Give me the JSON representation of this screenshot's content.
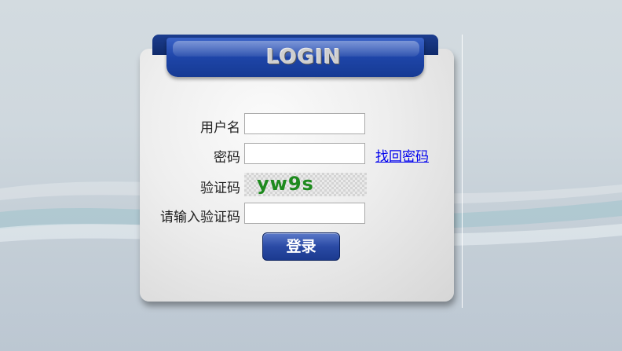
{
  "header": {
    "title": "LOGIN"
  },
  "form": {
    "username_label": "用户名",
    "username_value": "",
    "password_label": "密码",
    "password_value": "",
    "forgot_link": "找回密码",
    "captcha_label": "验证码",
    "captcha_text": "yw9s",
    "captcha_input_label": "请输入验证码",
    "captcha_input_value": "",
    "submit_label": "登录"
  }
}
